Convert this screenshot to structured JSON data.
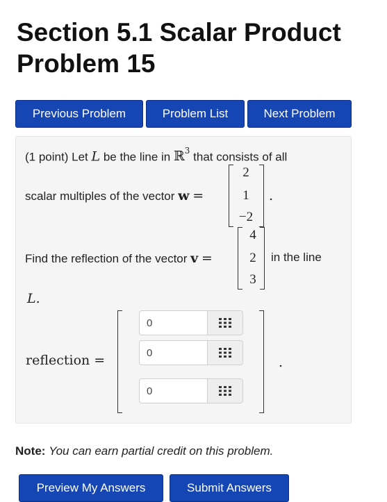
{
  "page": {
    "title_line1": "Section 5.1 Scalar Product",
    "title_line2": "Problem 15"
  },
  "nav": {
    "previous_label": "Previous Problem",
    "list_label": "Problem List",
    "next_label": "Next Problem"
  },
  "problem": {
    "points": "(1 point)",
    "line1_a": "Let",
    "var_L": "L",
    "line1_b": "be the line in",
    "space_R": "ℝ",
    "space_exp": "3",
    "line1_c": "that consists of all",
    "line2_a": "scalar multiples of the vector",
    "vec_w": "w",
    "equals": "=",
    "w_values": [
      "2",
      "1",
      "−2"
    ],
    "period": ".",
    "line3_a": "Find the reflection of the vector",
    "vec_v": "v",
    "v_values": [
      "4",
      "2",
      "3"
    ],
    "line3_b": "in the line",
    "line4": "L."
  },
  "answer": {
    "label": "reflection =",
    "inputs": [
      {
        "value": "0"
      },
      {
        "value": "0"
      },
      {
        "value": "0"
      }
    ],
    "matrix_button_icon": "grid-icon",
    "trailing_period": "."
  },
  "note": {
    "label": "Note:",
    "text": "You can earn partial credit on this problem."
  },
  "actions": {
    "preview_label": "Preview My Answers",
    "submit_label": "Submit Answers"
  },
  "colors": {
    "button_bg": "#1646b4",
    "panel_bg": "#f5f5f5"
  }
}
